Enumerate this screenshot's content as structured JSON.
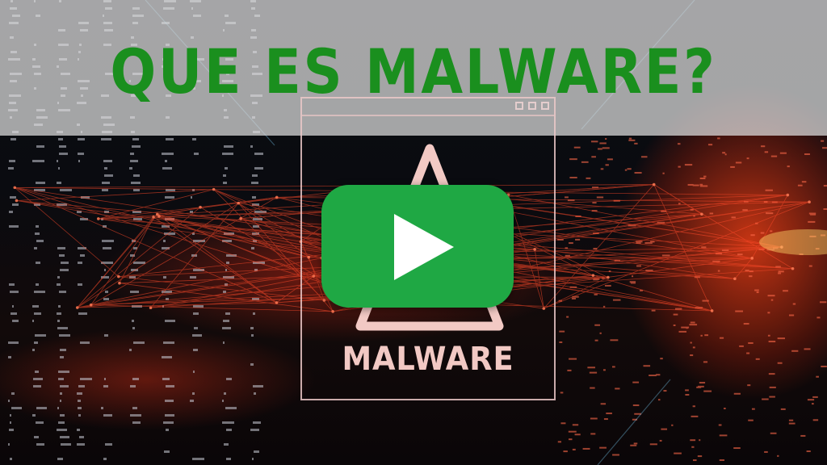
{
  "title": "QUE ES MALWARE?",
  "window_label": "MALWARE",
  "icons": {
    "play": "play-icon",
    "warning": "warning-triangle-icon"
  },
  "colors": {
    "title_green": "#1a8f1e",
    "play_green": "#1fa844",
    "band": "#e1e1e1",
    "glow_red": "#e63c14"
  }
}
